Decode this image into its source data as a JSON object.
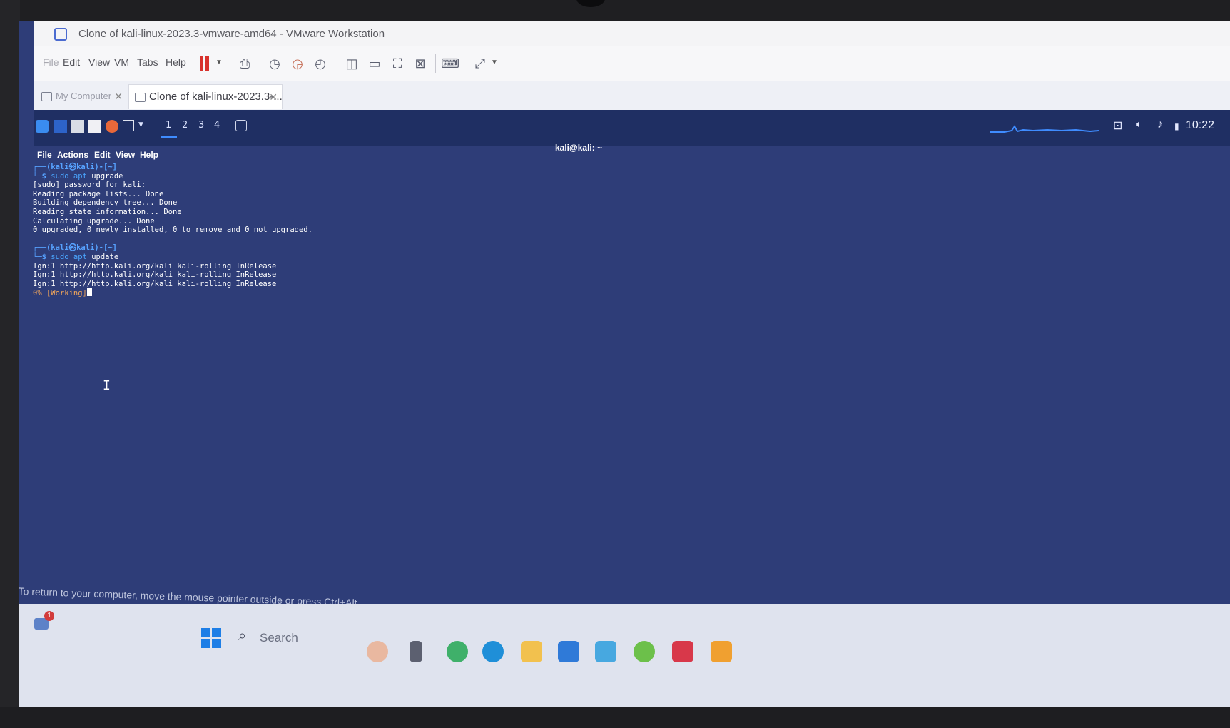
{
  "vmware": {
    "title": "Clone of kali-linux-2023.3-vmware-amd64 - VMware Workstation",
    "menu": [
      "File",
      "Edit",
      "View",
      "VM",
      "Tabs",
      "Help"
    ],
    "tabs": [
      {
        "label": "My Computer",
        "active": false
      },
      {
        "label": "Clone of kali-linux-2023.3-...",
        "active": true
      }
    ]
  },
  "kali_panel": {
    "workspaces": [
      "1",
      "2",
      "3",
      "4"
    ],
    "clock": "10:22"
  },
  "terminal": {
    "window_title": "kali@kali: ~",
    "menu": [
      "File",
      "Actions",
      "Edit",
      "View",
      "Help"
    ],
    "session1": {
      "prompt": "┌──(kali㉿kali)-[~]",
      "command_prefix": "└─$ ",
      "command_sudo": "sudo",
      "command_apt": "apt",
      "command_arg": "upgrade",
      "output": [
        "[sudo] password for kali:",
        "Reading package lists... Done",
        "Building dependency tree... Done",
        "Reading state information... Done",
        "Calculating upgrade... Done",
        "0 upgraded, 0 newly installed, 0 to remove and 0 not upgraded."
      ]
    },
    "session2": {
      "prompt": "┌──(kali㉿kali)-[~]",
      "command_prefix": "└─$ ",
      "command_sudo": "sudo",
      "command_apt": "apt",
      "command_arg": "update",
      "output": [
        "Ign:1 http://http.kali.org/kali kali-rolling InRelease",
        "Ign:1 http://http.kali.org/kali kali-rolling InRelease",
        "Ign:1 http://http.kali.org/kali kali-rolling InRelease"
      ],
      "status": "0% [Working]"
    }
  },
  "host": {
    "hint": "To return to your computer, move the mouse pointer outside or press Ctrl+Alt.",
    "search_placeholder": "Search",
    "notification_count": "1"
  },
  "colors": {
    "kali_desktop": "#2e3d78",
    "prompt_blue": "#57a2ff",
    "pause_red": "#d8322d",
    "working_orange": "#f2a65a"
  }
}
